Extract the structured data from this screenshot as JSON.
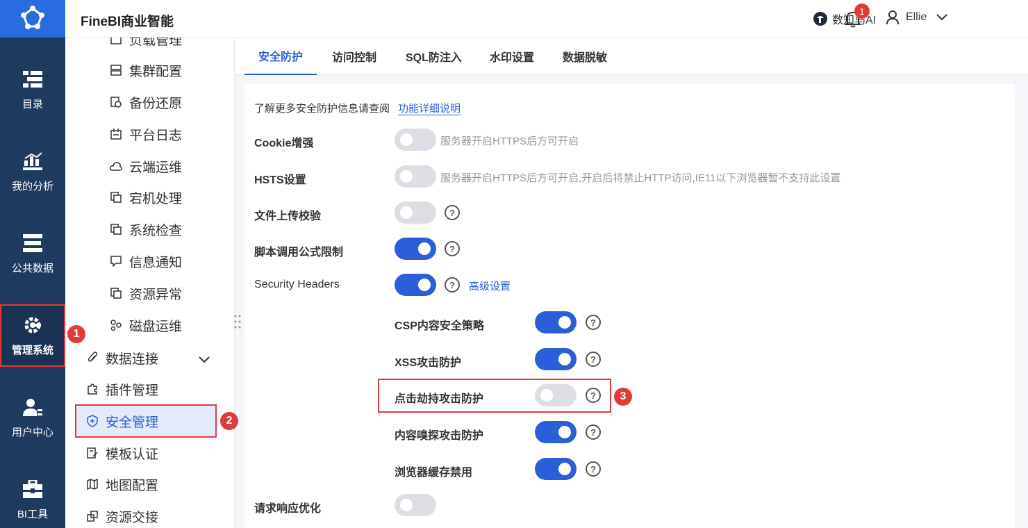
{
  "app": {
    "brand": "FineBI商业智能"
  },
  "header": {
    "ai_label": "数知鸟AI",
    "notification_count": "1",
    "user_name": "Ellie"
  },
  "rail": {
    "items": [
      {
        "label": "目录",
        "icon": "catalog-icon"
      },
      {
        "label": "我的分析",
        "icon": "analysis-chart-icon"
      },
      {
        "label": "公共数据",
        "icon": "public-data-icon"
      },
      {
        "label": "管理系统",
        "icon": "admin-gear-icon"
      },
      {
        "label": "用户中心",
        "icon": "user-center-icon"
      },
      {
        "label": "BI工具",
        "icon": "toolbox-icon"
      }
    ]
  },
  "submenu": {
    "items": [
      {
        "label": "负载管理"
      },
      {
        "label": "集群配置"
      },
      {
        "label": "备份还原"
      },
      {
        "label": "平台日志"
      },
      {
        "label": "云端运维"
      },
      {
        "label": "宕机处理"
      },
      {
        "label": "系统检查"
      },
      {
        "label": "信息通知"
      },
      {
        "label": "资源异常"
      },
      {
        "label": "磁盘运维"
      },
      {
        "label": "数据连接"
      },
      {
        "label": "插件管理"
      },
      {
        "label": "安全管理"
      },
      {
        "label": "模板认证"
      },
      {
        "label": "地图配置"
      },
      {
        "label": "资源交接"
      }
    ]
  },
  "tabs": [
    {
      "label": "安全防护"
    },
    {
      "label": "访问控制"
    },
    {
      "label": "SQL防注入"
    },
    {
      "label": "水印设置"
    },
    {
      "label": "数据脱敏"
    }
  ],
  "content": {
    "info_text": "了解更多安全防护信息请查阅",
    "info_link": "功能详细说明",
    "settings": [
      {
        "label": "Cookie增强",
        "on": false,
        "hint": "服务器开启HTTPS后方可开启"
      },
      {
        "label": "HSTS设置",
        "on": false,
        "hint": "服务器开启HTTPS后方可开启,开启后将禁止HTTP访问,IE11以下浏览器暂不支持此设置"
      },
      {
        "label": "文件上传校验",
        "on": false,
        "help": "?"
      },
      {
        "label": "脚本调用公式限制",
        "on": true,
        "help": "?"
      },
      {
        "label": "Security Headers",
        "on": true,
        "help": "?",
        "link": "高级设置"
      },
      {
        "label": "CSP内容安全策略",
        "on": true,
        "help": "?"
      },
      {
        "label": "XSS攻击防护",
        "on": true,
        "help": "?"
      },
      {
        "label": "点击劫持攻击防护",
        "on": false,
        "help": "?"
      },
      {
        "label": "内容嗅探攻击防护",
        "on": true,
        "help": "?"
      },
      {
        "label": "浏览器缓存禁用",
        "on": true,
        "help": "?"
      },
      {
        "label": "请求响应优化",
        "on": false
      }
    ]
  },
  "markers": [
    "1",
    "2",
    "3"
  ],
  "colors": {
    "accent": "#2b5fd9",
    "rail": "#1f3a5f",
    "marker": "#e03b3b",
    "toggle_off": "#dcdee3"
  }
}
